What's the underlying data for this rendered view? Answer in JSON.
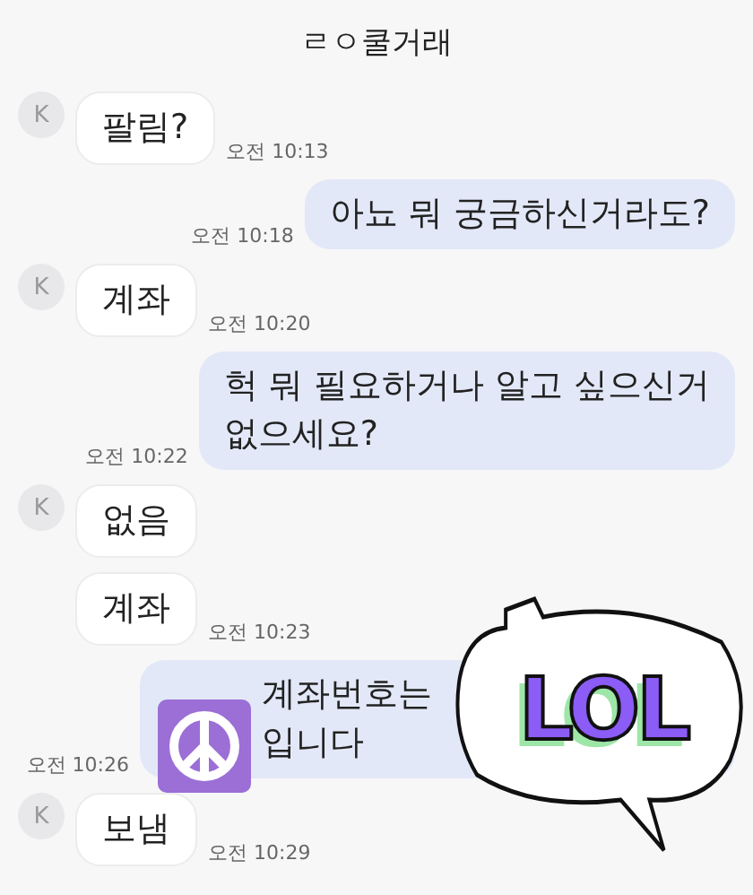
{
  "window": {
    "title": "ㄹㅇ쿨거래"
  },
  "messages": [
    {
      "kind": "in",
      "avatar": "K",
      "lines": [
        "팔림?"
      ],
      "time": "오전 10:13"
    },
    {
      "kind": "out",
      "lines": [
        "아뇨 뭐 궁금하신거라도?"
      ],
      "time": "오전 10:18"
    },
    {
      "kind": "in",
      "avatar": "K",
      "lines": [
        "계좌"
      ],
      "time": "오전 10:20"
    },
    {
      "kind": "out",
      "lines": [
        "헉 뭐 필요하거나 알고 싶으신거",
        "없으세요?"
      ],
      "time": "오전 10:22"
    },
    {
      "kind": "in",
      "avatar": "K",
      "lines": [
        "없음"
      ]
    },
    {
      "kind": "in",
      "lines": [
        "계좌"
      ],
      "time": "오전 10:23"
    },
    {
      "kind": "out",
      "lines": [
        "계좌번호는",
        "입니다"
      ],
      "time": "오전 10:26",
      "stickers": [
        {
          "kind": "peace"
        },
        {
          "kind": "lol",
          "text": "LOL"
        }
      ]
    },
    {
      "kind": "in",
      "avatar": "K",
      "lines": [
        "보냄"
      ],
      "time": "오전 10:29"
    }
  ]
}
